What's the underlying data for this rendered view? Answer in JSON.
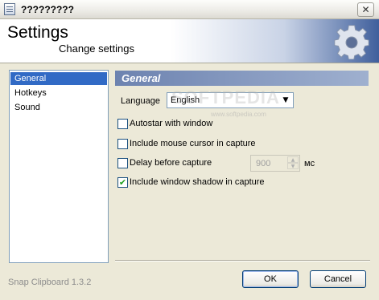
{
  "window": {
    "title": "?????????",
    "close_glyph": "✕"
  },
  "header": {
    "title": "Settings",
    "subtitle": "Change settings",
    "icon": "gear-icon"
  },
  "sidebar": {
    "items": [
      {
        "label": "General",
        "selected": true
      },
      {
        "label": "Hotkeys",
        "selected": false
      },
      {
        "label": "Sound",
        "selected": false
      }
    ]
  },
  "panel": {
    "title": "General",
    "language": {
      "label": "Language",
      "value": "English"
    },
    "watermark": {
      "text": "SOFTPEDIA",
      "sub": "www.softpedia.com"
    },
    "options": [
      {
        "label": "Autostar with window",
        "checked": false
      },
      {
        "label": "Include mouse cursor in capture",
        "checked": false
      },
      {
        "label": "Delay before capture",
        "checked": false
      },
      {
        "label": "Include window shadow in capture",
        "checked": true
      }
    ],
    "delay": {
      "value": "900",
      "unit": "мс",
      "enabled": false
    }
  },
  "footer": {
    "version": "Snap Clipboard 1.3.2",
    "ok_label": "OK",
    "cancel_label": "Cancel"
  },
  "colors": {
    "selection": "#316ac5",
    "section_header": "#6d83b0",
    "check": "#21a121"
  }
}
